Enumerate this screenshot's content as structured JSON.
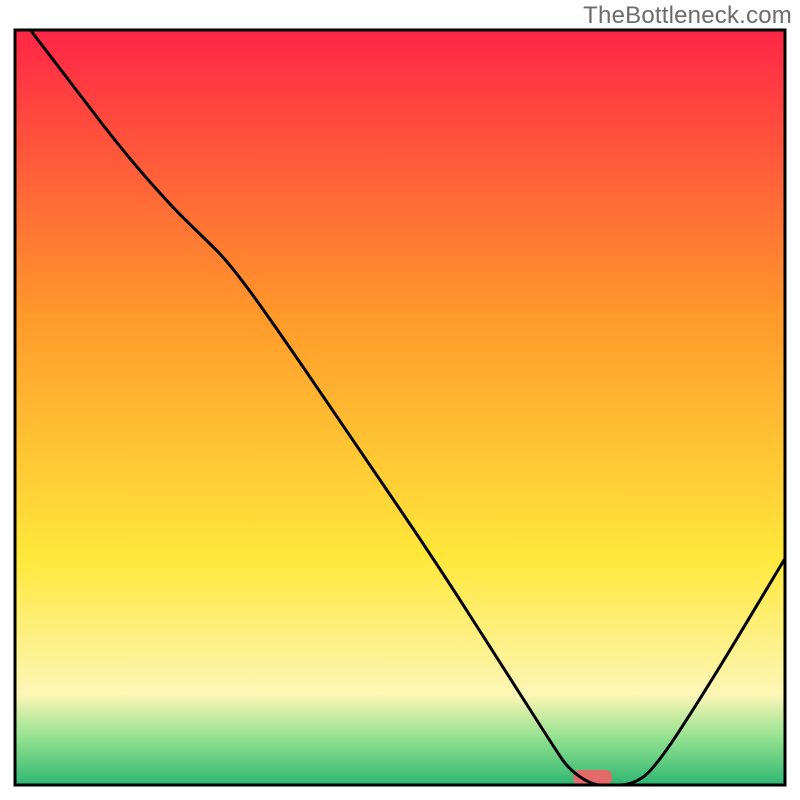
{
  "watermark": "TheBottleneck.com",
  "chart_data": {
    "type": "line",
    "title": "",
    "xlabel": "",
    "ylabel": "",
    "xlim": [
      0,
      100
    ],
    "ylim": [
      0,
      100
    ],
    "grid": false,
    "legend": false,
    "series": [
      {
        "name": "bottleneck-curve",
        "x": [
          2,
          8,
          14,
          20,
          24,
          28,
          35,
          45,
          55,
          65,
          70,
          72,
          75,
          77,
          80,
          83,
          90,
          100
        ],
        "y": [
          100,
          92,
          84,
          77,
          73,
          69,
          59,
          44,
          29,
          13,
          5,
          2,
          0,
          0,
          0,
          2,
          13,
          30
        ]
      }
    ],
    "marker": {
      "name": "optimal-zone",
      "x": 75,
      "y": 1,
      "width": 5,
      "height": 2,
      "color": "#e46a6a"
    },
    "background_gradient": {
      "top_color": "#ff2547",
      "mid_top_color": "#ff9a2b",
      "mid_color": "#ffe83b",
      "pale_yellow": "#fdf6b6",
      "green_top": "#8ee08e",
      "green_bottom": "#2fb673"
    },
    "frame_color": "#000000"
  }
}
